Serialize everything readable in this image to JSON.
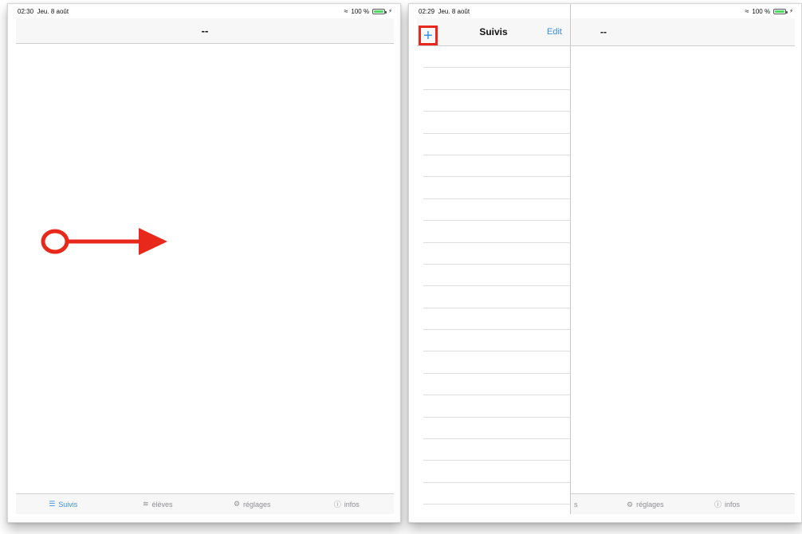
{
  "left_screen": {
    "status": {
      "time": "02:30",
      "date": "Jeu. 8 août",
      "battery_text": "100 %",
      "battery_level": 1.0
    },
    "nav_title": "--",
    "tabs": [
      {
        "label": "Suivis",
        "icon": "list-icon",
        "active": true
      },
      {
        "label": "élèves",
        "icon": "people-icon",
        "active": false
      },
      {
        "label": "réglages",
        "icon": "gear-icon",
        "active": false
      },
      {
        "label": "infos",
        "icon": "info-icon",
        "active": false
      }
    ]
  },
  "right_screen": {
    "status": {
      "time": "02:29",
      "date": "Jeu. 8 août",
      "battery_text": "100 %",
      "battery_level": 1.0
    },
    "master": {
      "title": "Suivis",
      "add_symbol": "+",
      "edit_label": "Edit",
      "row_count": 21
    },
    "detail": {
      "title": "--"
    },
    "tabs": [
      {
        "label": "s",
        "icon": "",
        "active": false
      },
      {
        "label": "réglages",
        "icon": "gear-icon",
        "active": false
      },
      {
        "label": "infos",
        "icon": "info-icon",
        "active": false
      }
    ]
  },
  "colors": {
    "accent": "#3a8ee6",
    "annotation": "#e8281a",
    "battery": "#4cd964"
  }
}
